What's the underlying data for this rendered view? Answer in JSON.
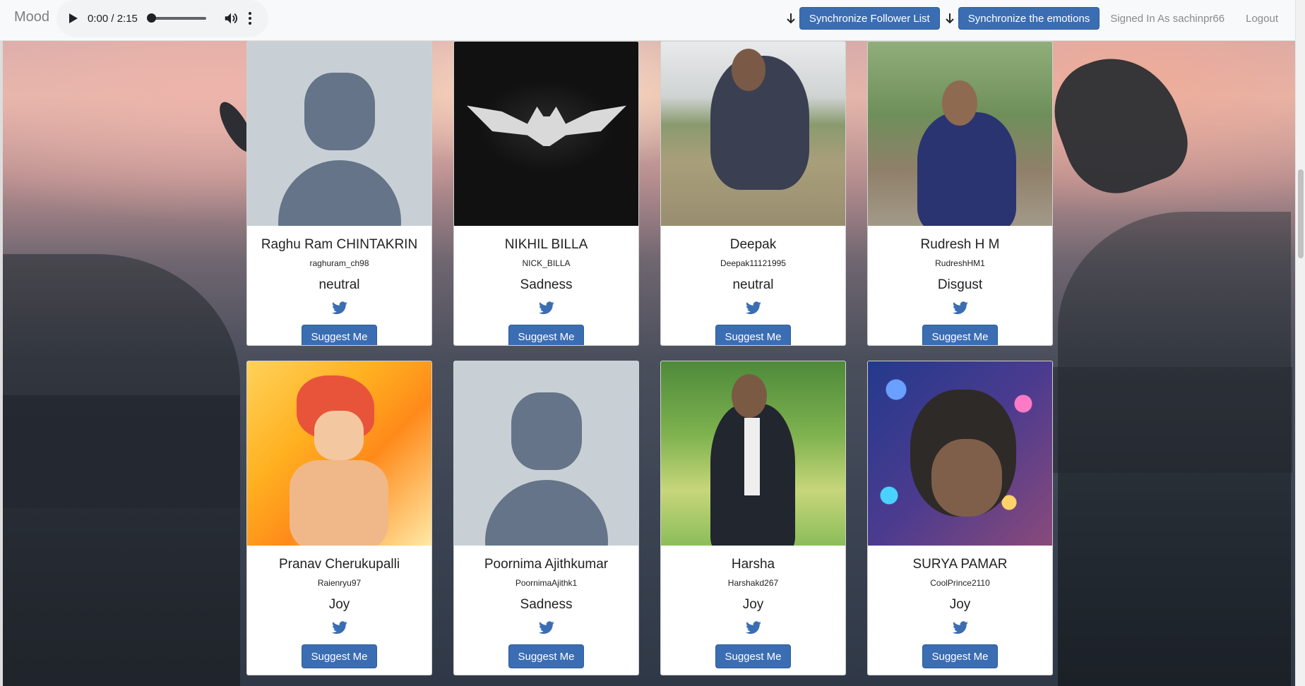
{
  "navbar": {
    "brand": "Mood",
    "audio": {
      "time": "0:00 / 2:15",
      "progress": 0
    },
    "sync_followers_label": "Synchronize Follower List",
    "sync_emotions_label": "Synchronize the emotions",
    "signed_in_text": "Signed In As sachinpr66",
    "logout_label": "Logout"
  },
  "colors": {
    "primary": "#3b6db3",
    "twitter": "#3b6db3",
    "placeholder_bg": "#c8d0d6",
    "placeholder_fg": "#657488"
  },
  "cards": [
    {
      "name": "Raghu Ram CHINTAKRIN",
      "handle": "raghuram_ch98",
      "emotion": "neutral",
      "button": "Suggest Me",
      "photo": "placeholder-avatar"
    },
    {
      "name": "NIKHIL BILLA",
      "handle": "NICK_BILLA",
      "emotion": "Sadness",
      "button": "Suggest Me",
      "photo": "bat-logo"
    },
    {
      "name": "Deepak",
      "handle": "Deepak11121995",
      "emotion": "neutral",
      "button": "Suggest Me",
      "photo": "person-sitting"
    },
    {
      "name": "Rudresh H M",
      "handle": "RudreshHM1",
      "emotion": "Disgust",
      "button": "Suggest Me",
      "photo": "person-outdoors"
    },
    {
      "name": "Pranav Cherukupalli",
      "handle": "Raienryu97",
      "emotion": "Joy",
      "button": "Suggest Me",
      "photo": "anime-character"
    },
    {
      "name": "Poornima Ajithkumar",
      "handle": "PoornimaAjithk1",
      "emotion": "Sadness",
      "button": "Suggest Me",
      "photo": "placeholder-avatar"
    },
    {
      "name": "Harsha",
      "handle": "Harshakd267",
      "emotion": "Joy",
      "button": "Suggest Me",
      "photo": "person-suit"
    },
    {
      "name": "SURYA PAMAR",
      "handle": "CoolPrince2110",
      "emotion": "Joy",
      "button": "Suggest Me",
      "photo": "person-bokeh"
    }
  ]
}
